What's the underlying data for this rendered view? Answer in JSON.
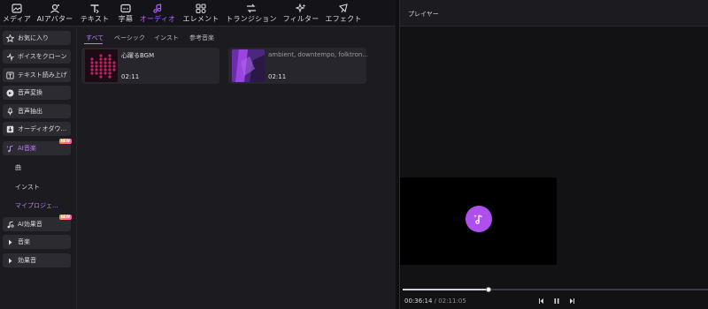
{
  "toolbar": {
    "items": [
      {
        "label": "メディア",
        "icon": "media-icon"
      },
      {
        "label": "AIアバター",
        "icon": "avatar-icon"
      },
      {
        "label": "テキスト",
        "icon": "text-icon"
      },
      {
        "label": "字幕",
        "icon": "subtitle-icon"
      },
      {
        "label": "オーディオ",
        "icon": "audio-icon",
        "active": true
      },
      {
        "label": "エレメント",
        "icon": "element-icon"
      },
      {
        "label": "トランジション",
        "icon": "transition-icon"
      },
      {
        "label": "フィルター",
        "icon": "filter-icon"
      },
      {
        "label": "エフェクト",
        "icon": "effect-icon"
      }
    ]
  },
  "sidebar": {
    "items": [
      {
        "label": "お気に入り",
        "icon": "star-icon"
      },
      {
        "label": "ボイスをクローン",
        "icon": "voice-clone-icon"
      },
      {
        "label": "テキスト読み上げ",
        "icon": "tts-icon"
      },
      {
        "label": "音声変換",
        "icon": "voice-change-icon"
      },
      {
        "label": "音声抽出",
        "icon": "mic-icon"
      },
      {
        "label": "オーディオダウ...",
        "icon": "audio-download-icon"
      },
      {
        "label": "AI音楽",
        "icon": "ai-music-icon",
        "badge": "NEW"
      },
      {
        "label": "AI効果音",
        "icon": "ai-sfx-icon",
        "badge": "NEW"
      },
      {
        "label": "音楽",
        "icon": "caret-right-icon"
      },
      {
        "label": "効果音",
        "icon": "caret-right-icon"
      }
    ],
    "sub_items": [
      "曲",
      "インスト",
      "マイプロジェ..."
    ]
  },
  "tabs": [
    "すべて",
    "ベーシック",
    "インスト",
    "参考音楽"
  ],
  "cards": [
    {
      "title": "心躍るBGM",
      "duration": "02:11"
    },
    {
      "title": "ambient, downtempo, folktron...",
      "duration": "02:11"
    }
  ],
  "player": {
    "title": "プレイヤー",
    "current_time": "00:36:14",
    "total_time": "/ 02:11:05",
    "progress": 0.28
  },
  "colors": {
    "accent": "#b15cff",
    "play_button": "#b04ff0",
    "badge": "#ff6f7a"
  }
}
